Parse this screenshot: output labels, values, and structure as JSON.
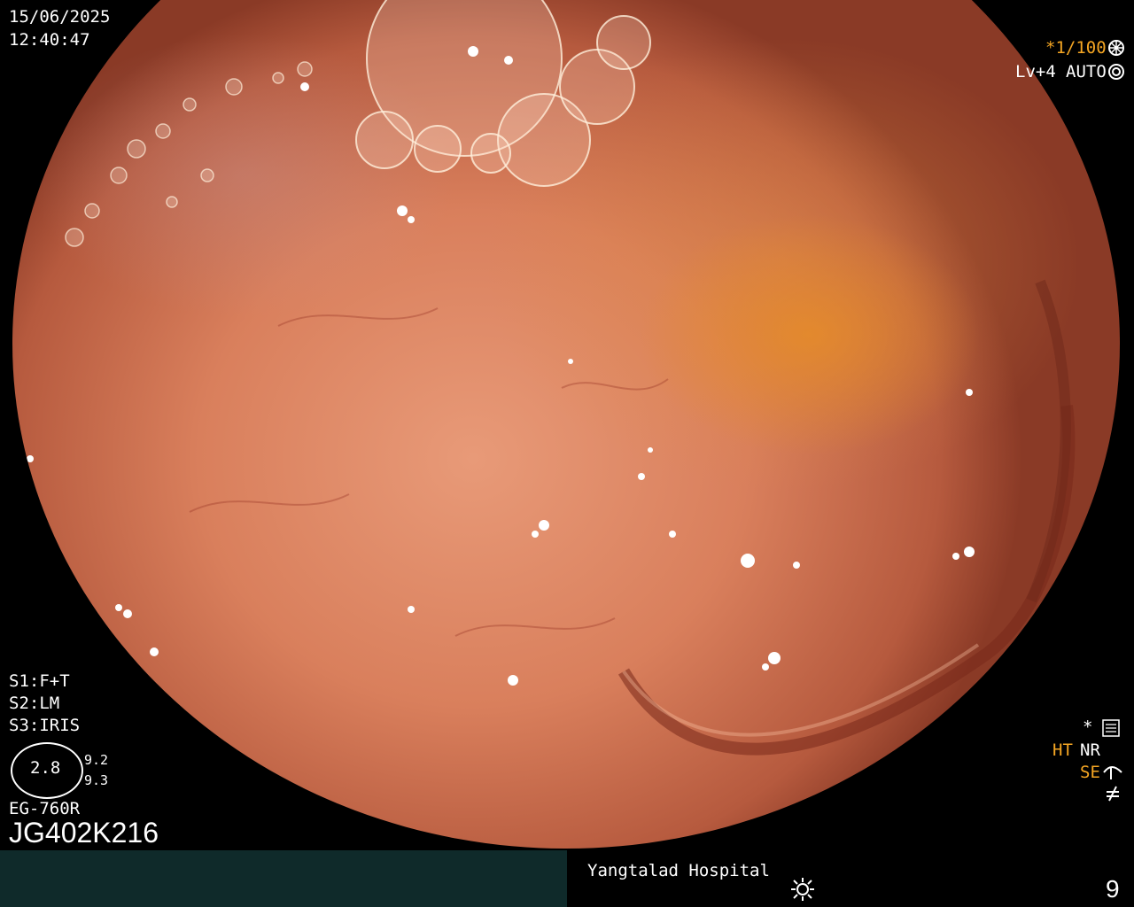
{
  "overlay": {
    "date": "15/06/2025",
    "time": "12:40:47",
    "shutter": "*1/100",
    "level": "Lv+4",
    "iris_mode": "AUTO",
    "settings": [
      "S1:F+T",
      "S2:LM",
      "S3:IRIS"
    ],
    "gauge_value": "2.8",
    "gauge_side_top": "9.2",
    "gauge_side_bottom": "9.3",
    "scope_model": "EG-760R",
    "scope_serial": "JG402K216",
    "right_flags": {
      "star": "*",
      "ht": "HT",
      "nr": "NR",
      "se": "SE"
    },
    "hospital": "Yangtalad Hospital",
    "counter": "9"
  },
  "colors": {
    "orange_text": "#f5a623",
    "bottom_bar": "#0f2a2a"
  },
  "icons": [
    "aperture-icon",
    "iris-icon",
    "settings-sliders-icon",
    "se-curve-icon",
    "not-equal-icon",
    "sun-icon"
  ]
}
